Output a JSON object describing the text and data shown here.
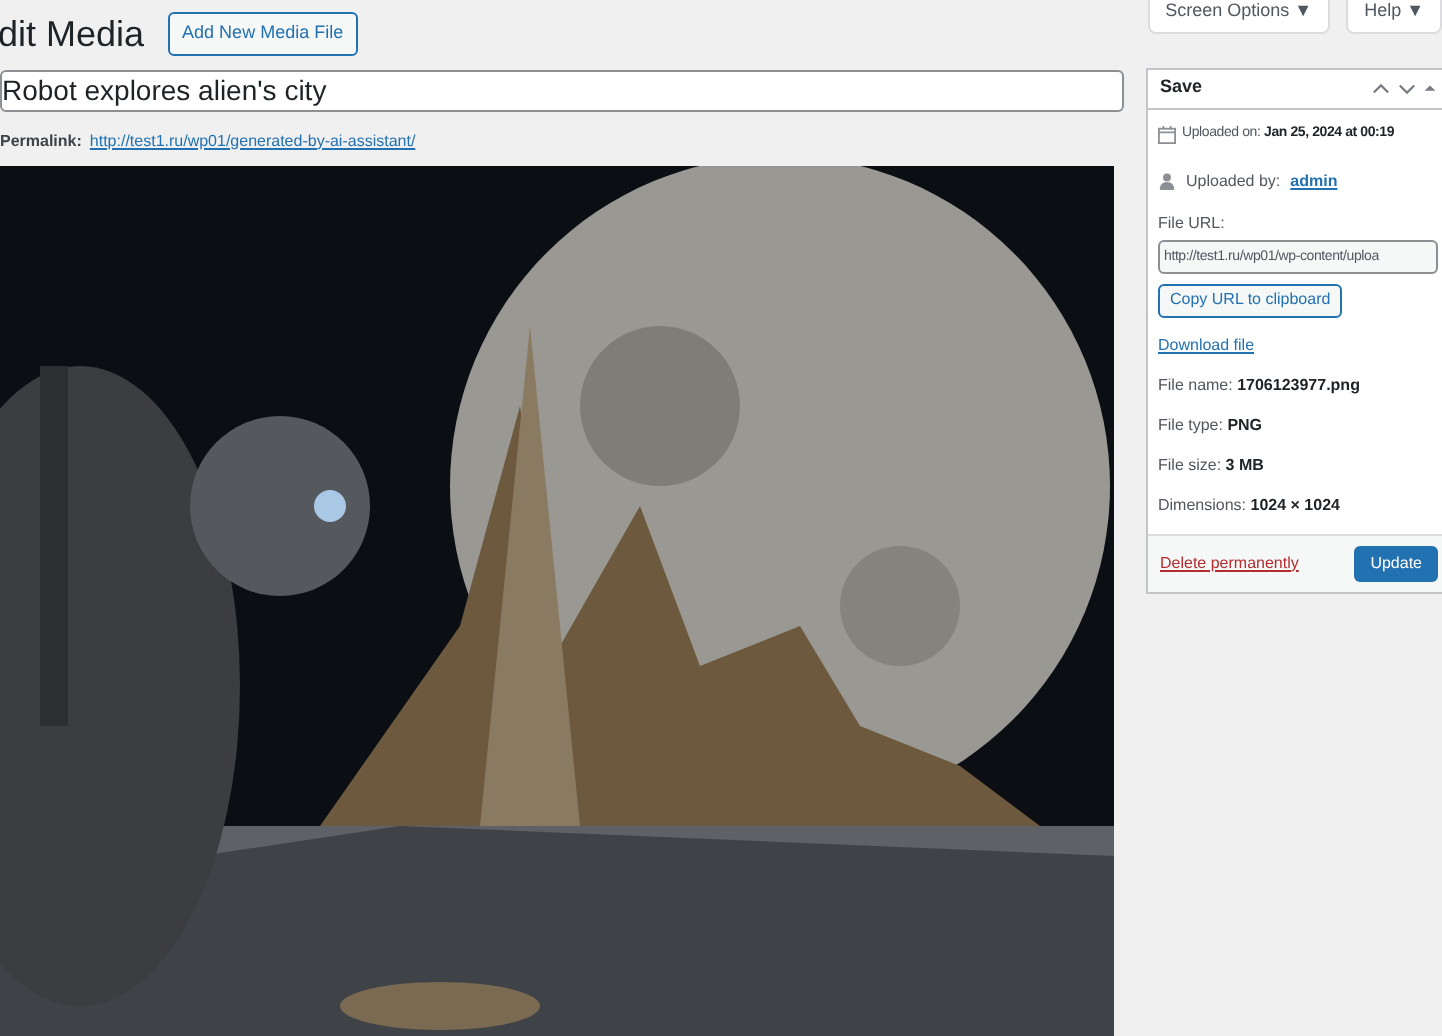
{
  "header_buttons": [
    {
      "label": "Screen Options ▼"
    },
    {
      "label": "Help ▼"
    }
  ],
  "heading": "dit Media",
  "add_button": "Add New Media File",
  "title_field": {
    "value": "Robot explores alien's city"
  },
  "permalink": {
    "label": "Permalink:",
    "url": "http://test1.ru/wp01/generated-by-ai-assistant/"
  },
  "save_box": {
    "title": "Save",
    "expanded": true,
    "uploaded_on": "Uploaded on: **Jan 25, 2024 at 00:19**",
    "uploaded_by_label": "Uploaded by:",
    "uploaded_by": "admin",
    "file_url_label": "File URL:",
    "file_url": "http://test1.ru/wp01/wp-content/uploa",
    "copy_button": "Copy URL to clipboard",
    "download_link": "Download file",
    "details": [
      "File name: **1706123977.png**",
      "File type: **PNG**",
      "File size: **3 MB**",
      "Dimensions: **1024 × 1024**"
    ],
    "delete_link": "Delete permanently",
    "update_button": "Update"
  }
}
